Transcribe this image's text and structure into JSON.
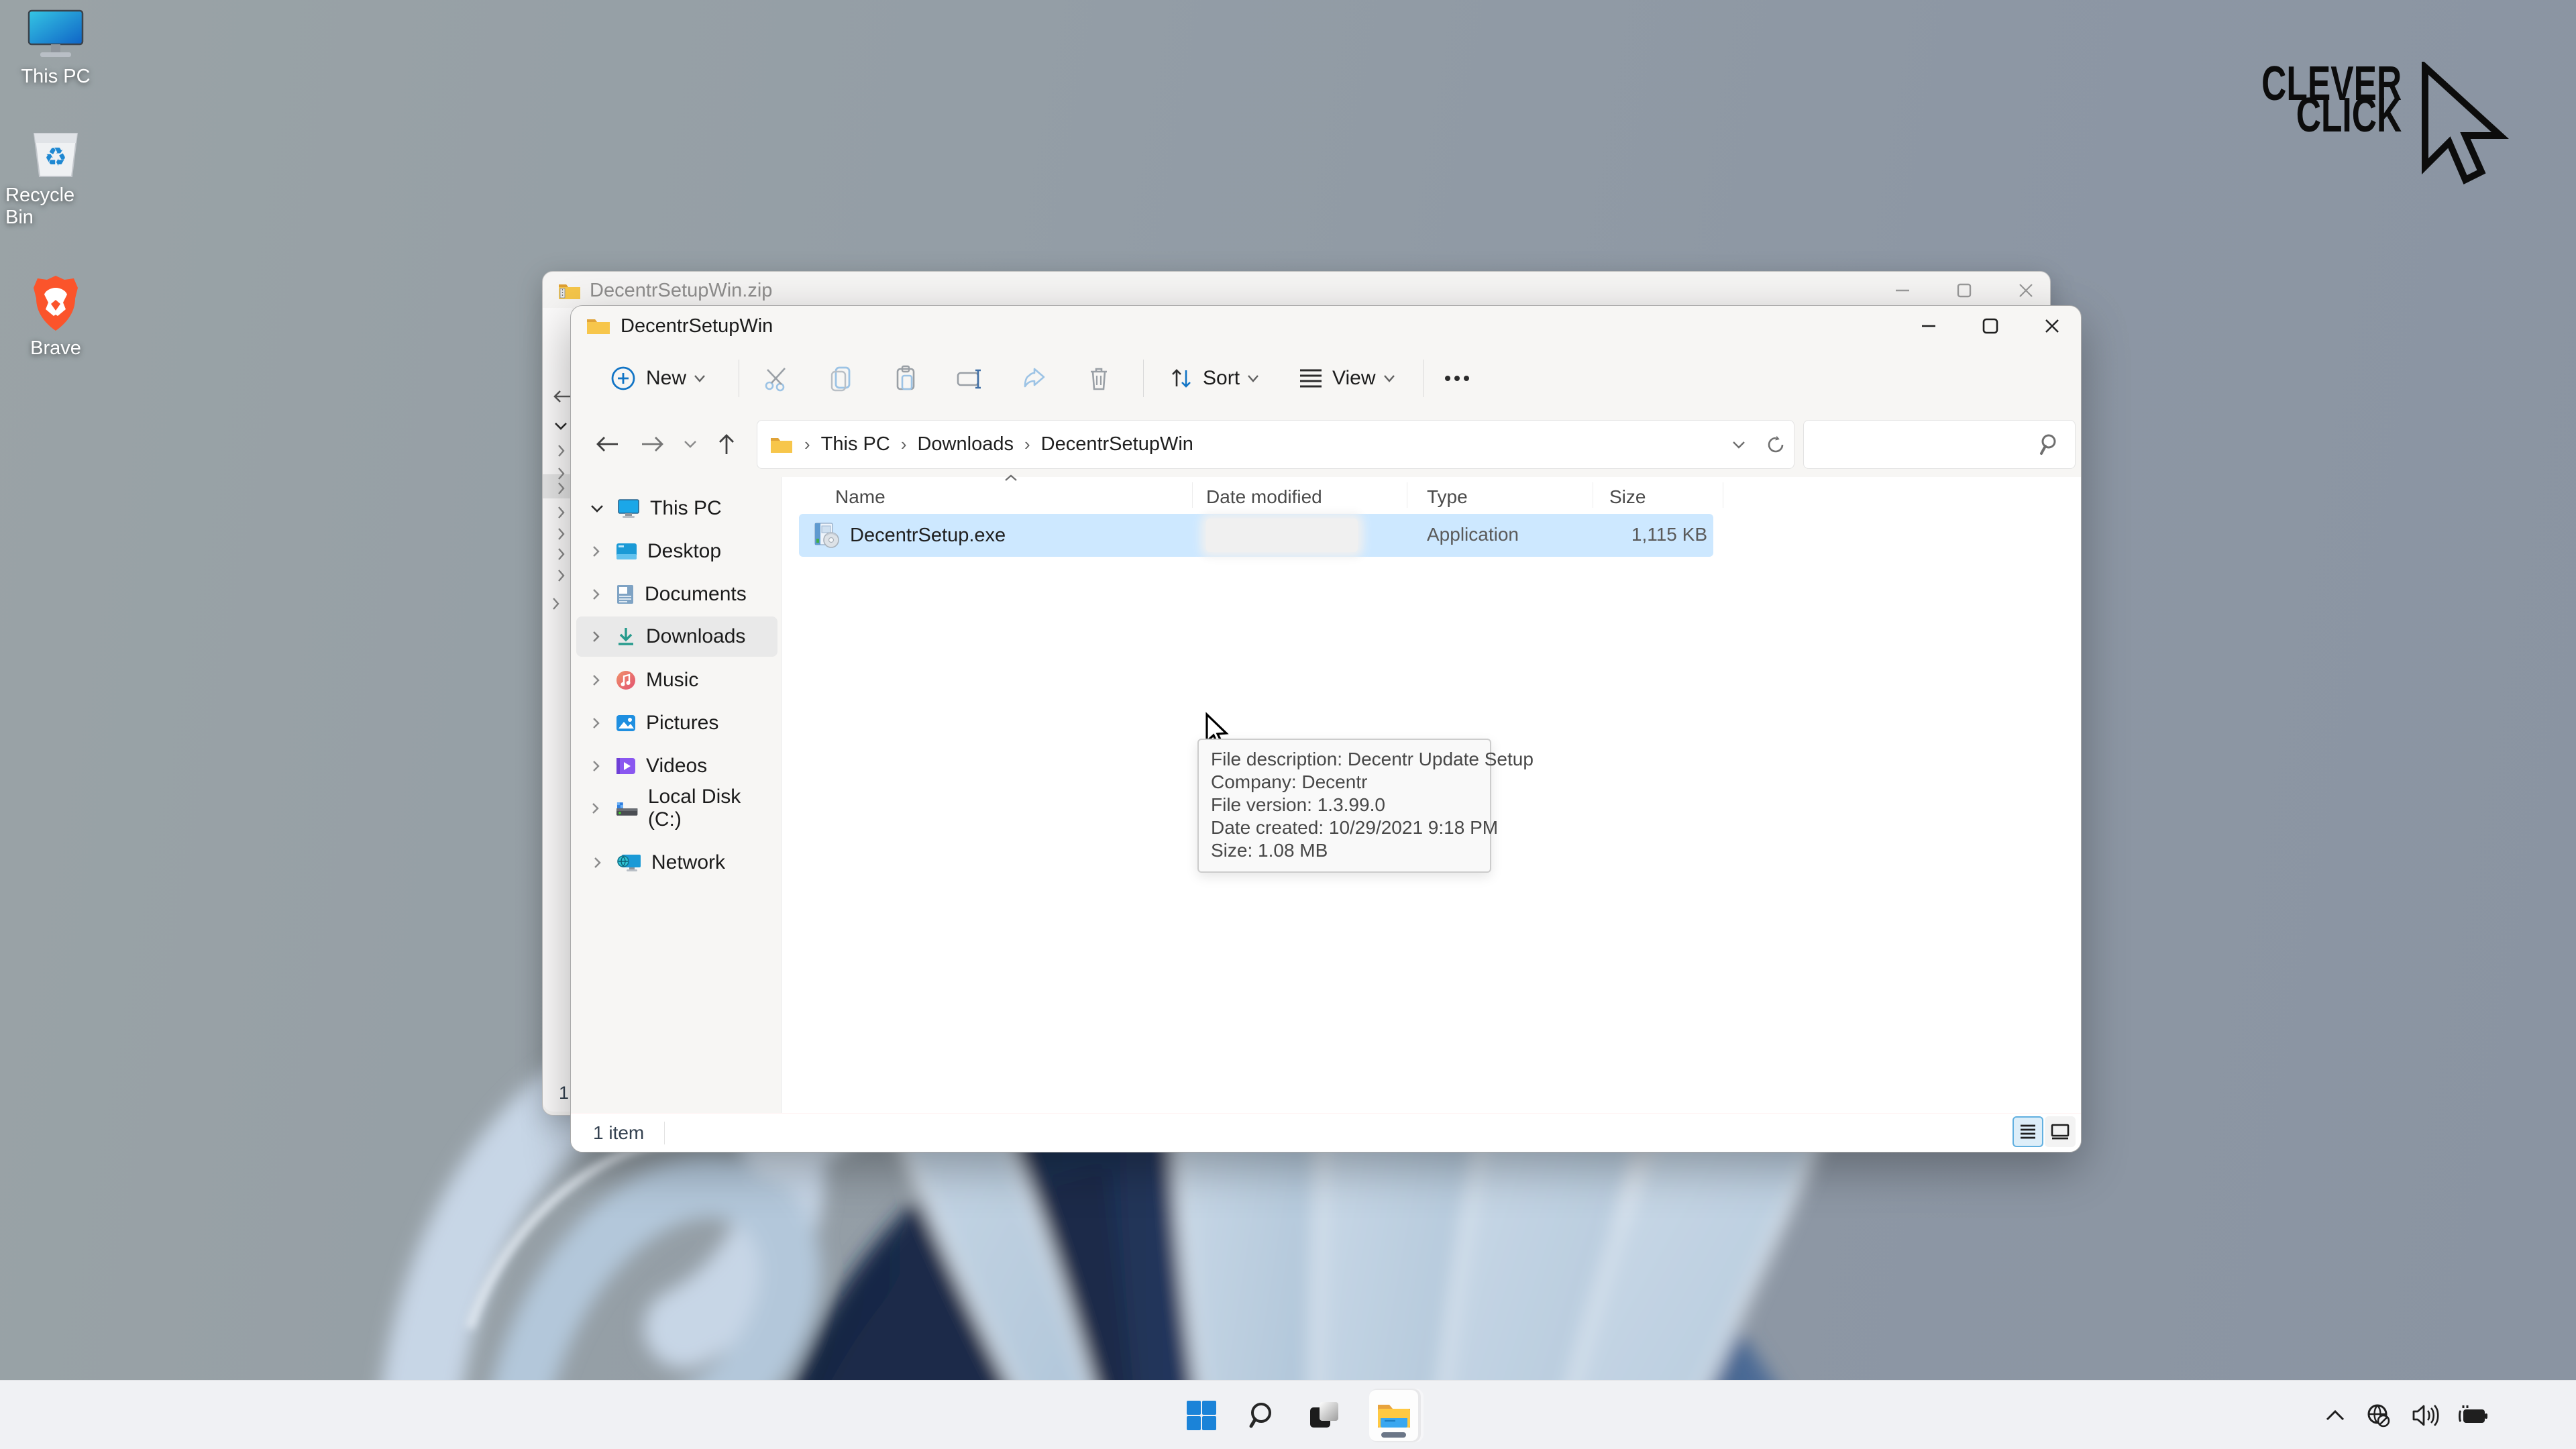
{
  "watermark": {
    "line1": "CLEVER",
    "line2": "CLICK"
  },
  "desktop_icons": [
    {
      "label": "This PC"
    },
    {
      "label": "Recycle Bin"
    },
    {
      "label": "Brave"
    }
  ],
  "back_window": {
    "title": "DecentrSetupWin.zip",
    "status_fragment": "1"
  },
  "explorer": {
    "title": "DecentrSetupWin",
    "toolbar": {
      "new": "New",
      "sort": "Sort",
      "view": "View"
    },
    "nav": {
      "crumbs": [
        "This PC",
        "Downloads",
        "DecentrSetupWin"
      ],
      "search_placeholder": ""
    },
    "columns": [
      "Name",
      "Date modified",
      "Type",
      "Size"
    ],
    "file": {
      "name": "DecentrSetup.exe",
      "type": "Application",
      "size": "1,115 KB"
    },
    "status": {
      "count": "1 item"
    }
  },
  "sidebar": {
    "items": [
      {
        "label": "This PC",
        "expanded": true
      },
      {
        "label": "Desktop"
      },
      {
        "label": "Documents"
      },
      {
        "label": "Downloads",
        "selected": true
      },
      {
        "label": "Music"
      },
      {
        "label": "Pictures"
      },
      {
        "label": "Videos"
      },
      {
        "label": "Local Disk (C:)"
      },
      {
        "label": "Network"
      }
    ]
  },
  "tooltip": {
    "lines": [
      "File description: Decentr Update Setup",
      "Company: Decentr",
      "File version: 1.3.99.0",
      "Date created: 10/29/2021 9:18 PM",
      "Size: 1.08 MB"
    ]
  },
  "icons": {
    "toolbar": [
      "plus-circle-new",
      "scissors-cut",
      "copy",
      "clipboard-paste",
      "rename",
      "share",
      "trash-delete",
      "sort-arrows",
      "view-lines",
      "ellipsis-more"
    ],
    "navigation": [
      "arrow-back",
      "arrow-forward",
      "chevron-down",
      "arrow-up",
      "refresh",
      "search-magnifier"
    ],
    "taskbar": [
      "windows-start",
      "search-magnifier",
      "task-view",
      "file-explorer-folder"
    ],
    "tray": [
      "chevron-up-hidden-icons",
      "globe-no-internet",
      "volume-speaker",
      "battery-charging"
    ]
  },
  "colors": {
    "selection_row": "#cde8ff",
    "sidebar_selected": "#e9e9e9",
    "accent_blue": "#0067c0",
    "tooltip_bg": "#f9f9f9",
    "taskbar_bg": "#f0f1f4",
    "wallpaper_navy": "#1c2c4e",
    "wallpaper_petal": "#c3d5e4"
  }
}
